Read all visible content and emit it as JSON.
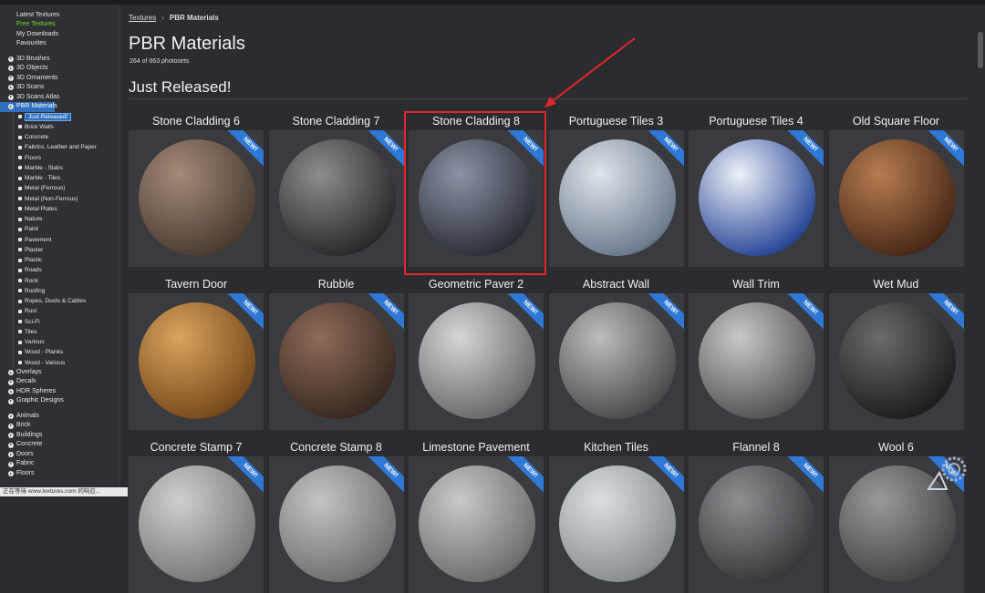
{
  "sidebar": {
    "top_links": [
      "Latest Textures",
      "Free Textures",
      "My Downloads",
      "Favourites"
    ],
    "groups_a": [
      "3D Brushes",
      "3D Objects",
      "3D Ornaments",
      "3D Scans",
      "3D Scans Atlas",
      "PBR Materials"
    ],
    "sub_items": [
      "Just Released!",
      "Brick Walls",
      "Concrete",
      "Fabrics, Leather and Paper",
      "Floors",
      "Marble - Slabs",
      "Marble - Tiles",
      "Metal (Ferrous)",
      "Metal (Non-Ferrous)",
      "Metal Plates",
      "Nature",
      "Paint",
      "Pavement",
      "Plaster",
      "Plastic",
      "Roads",
      "Rock",
      "Roofing",
      "Ropes, Ducts & Cables",
      "Rust",
      "Sci-Fi",
      "Tiles",
      "Various",
      "Wood - Planks",
      "Wood - Various"
    ],
    "groups_b": [
      "Overlays",
      "Decals",
      "HDR Spheres",
      "Graphic Designs"
    ],
    "groups_c": [
      "Animals",
      "Brick",
      "Buildings",
      "Concrete",
      "Doors",
      "Fabric",
      "Floors"
    ]
  },
  "status_text": "正在等待 www.textures.com 的响应...",
  "breadcrumb": {
    "root": "Textures",
    "sep": "›",
    "current": "PBR Materials"
  },
  "page_title": "PBR Materials",
  "count": "264 of 663 photosets",
  "section_title": "Just Released!",
  "badge": "NEW!",
  "cards": [
    {
      "name": "Stone Cladding 6",
      "c1": "#a38a78",
      "c2": "#4e3d33"
    },
    {
      "name": "Stone Cladding 7",
      "c1": "#8c8d8e",
      "c2": "#2a2b2c"
    },
    {
      "name": "Stone Cladding 8",
      "c1": "#8a93a6",
      "c2": "#2d3038"
    },
    {
      "name": "Portuguese Tiles 3",
      "c1": "#dfe4ea",
      "c2": "#6e7c90"
    },
    {
      "name": "Portuguese Tiles 4",
      "c1": "#eef1f8",
      "c2": "#2c4a9a"
    },
    {
      "name": "Old Square Floor",
      "c1": "#b77c50",
      "c2": "#4a2a18"
    },
    {
      "name": "Tavern Door",
      "c1": "#d9a45e",
      "c2": "#7a4b1c"
    },
    {
      "name": "Rubble",
      "c1": "#8e6b58",
      "c2": "#3a2a22"
    },
    {
      "name": "Geometric Paver 2",
      "c1": "#d6d6d8",
      "c2": "#6b6b6e"
    },
    {
      "name": "Abstract Wall",
      "c1": "#bdbdbd",
      "c2": "#4d4d4f"
    },
    {
      "name": "Wall Trim",
      "c1": "#c8c8c8",
      "c2": "#555557"
    },
    {
      "name": "Wet Mud",
      "c1": "#6b6b6b",
      "c2": "#1f1f20"
    },
    {
      "name": "Concrete Stamp 7",
      "c1": "#cfcfcf",
      "c2": "#7a7a7a"
    },
    {
      "name": "Concrete Stamp 8",
      "c1": "#c4c4c4",
      "c2": "#707070"
    },
    {
      "name": "Limestone Pavement",
      "c1": "#c9c9c9",
      "c2": "#6f6f6f"
    },
    {
      "name": "Kitchen Tiles",
      "c1": "#dcdfe2",
      "c2": "#8a8e92"
    },
    {
      "name": "Flannel 8",
      "c1": "#8f8f92",
      "c2": "#3a3a3d"
    },
    {
      "name": "Wool 6",
      "c1": "#9a9a9a",
      "c2": "#454545"
    }
  ],
  "colors": {
    "accent_blue": "#2f6fbd",
    "badge_blue": "#2f78d6",
    "free_green": "#6fdc2f",
    "highlight_red": "#e3262a"
  }
}
